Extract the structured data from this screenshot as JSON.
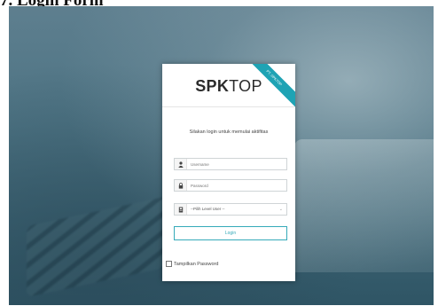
{
  "caption": "7. Login Form",
  "card": {
    "brand_bold": "SPK",
    "brand_light": "TOP",
    "ribbon_text": "PT. SPKTOP",
    "subtitle": "Silakan login untuk memulai aktifitas",
    "username_placeholder": "Username",
    "password_placeholder": "Password",
    "level_value": "--Pilih Level User --",
    "login_label": "Login",
    "show_password_label": "Tampilkan Password"
  },
  "colors": {
    "accent": "#35aab9",
    "ribbon": "#1fa3b4",
    "background": "#4d7383"
  },
  "icons": {
    "username": "user-icon",
    "password": "lock-icon",
    "level": "id-card-icon",
    "select": "chevron-down-icon"
  }
}
